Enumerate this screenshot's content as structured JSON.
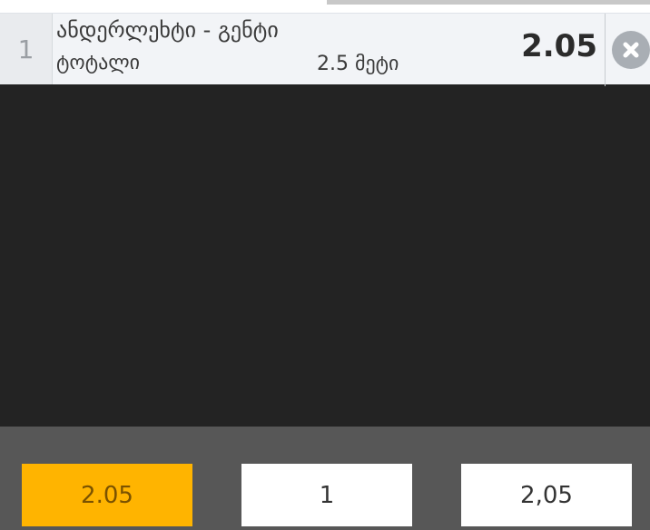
{
  "bet": {
    "index": "1",
    "match": "ანდერლეხტი - გენტი",
    "market": "ტოტალი",
    "selection": "2.5 მეტი",
    "odds": "2.05"
  },
  "summary": {
    "total_odds": "2.05",
    "stake": "1",
    "payout": "2,05"
  },
  "colors": {
    "accent": "#ffb400",
    "panel": "#575757",
    "background": "#232323"
  },
  "icons": {
    "remove": "close-circle-icon"
  }
}
